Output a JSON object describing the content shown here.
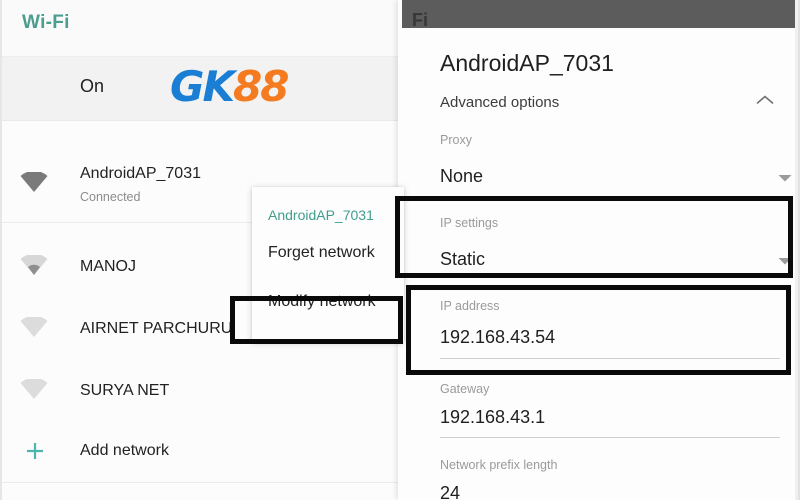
{
  "left_panel": {
    "header_title": "Wi-Fi",
    "toggle_state_label": "On",
    "watermark": {
      "part1": "GK",
      "part2": "88",
      "color1": "#1a7fd4",
      "color2": "#f47b20"
    },
    "networks": [
      {
        "ssid": "AndroidAP_7031",
        "status": "Connected",
        "signal_icon": "wifi-signal-full-icon"
      },
      {
        "ssid": "MANOJ",
        "status": "",
        "signal_icon": "wifi-signal-weak-icon"
      },
      {
        "ssid": "AIRNET PARCHURU",
        "status": "",
        "signal_icon": "wifi-signal-empty-icon"
      },
      {
        "ssid": "SURYA NET",
        "status": "",
        "signal_icon": "wifi-signal-empty-icon"
      }
    ],
    "add_network_label": "Add network",
    "add_network_icon": "plus-icon",
    "accent_color": "#4db6ac"
  },
  "context_menu": {
    "title": "AndroidAP_7031",
    "items": [
      {
        "label": "Forget network"
      },
      {
        "label": "Modify network",
        "highlighted": true
      }
    ]
  },
  "right_panel": {
    "topbar_text": "Fi",
    "dialog_title": "AndroidAP_7031",
    "advanced_options_label": "Advanced options",
    "advanced_options_icon": "chevron-up-icon",
    "fields": [
      {
        "label": "Proxy",
        "value": "None",
        "type": "dropdown",
        "highlighted": false
      },
      {
        "label": "IP settings",
        "value": "Static",
        "type": "dropdown",
        "highlighted": true
      },
      {
        "label": "IP address",
        "value": "192.168.43.54",
        "type": "text",
        "highlighted": true
      },
      {
        "label": "Gateway",
        "value": "192.168.43.1",
        "type": "text",
        "highlighted": false
      },
      {
        "label": "Network prefix length",
        "value": "24",
        "type": "text",
        "highlighted": false
      }
    ]
  }
}
